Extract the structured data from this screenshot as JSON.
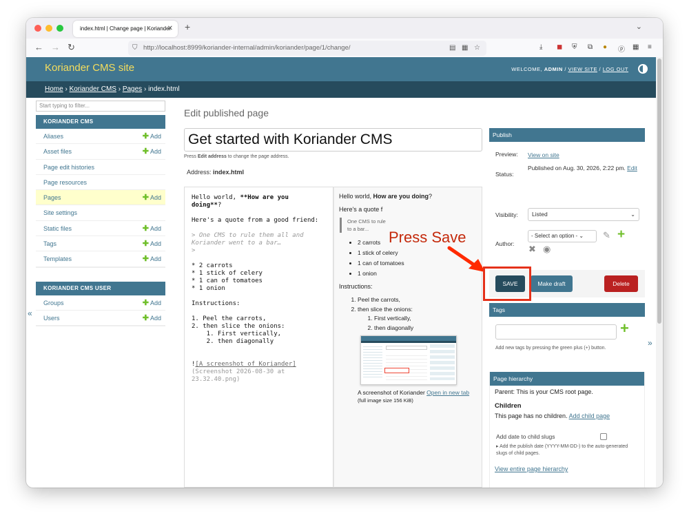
{
  "browser": {
    "tab_title": "index.html | Change page | Koriander",
    "url": "http://localhost:8999/koriander-internal/admin/koriander/page/1/change/"
  },
  "header": {
    "site_title": "Koriander CMS site",
    "welcome": "WELCOME, ",
    "user": "ADMIN",
    "view_site": "VIEW SITE",
    "separator": " / ",
    "logout": "LOG OUT"
  },
  "breadcrumb": {
    "home": "Home",
    "app": "Koriander CMS",
    "model": "Pages",
    "sep": " › ",
    "current": "index.html"
  },
  "sidebar": {
    "filter_placeholder": "Start typing to filter...",
    "add_label": "Add",
    "modules": [
      {
        "caption": "KORIANDER CMS",
        "items": [
          {
            "label": "Aliases",
            "add": true
          },
          {
            "label": "Asset files",
            "add": true
          },
          {
            "label": "Page edit histories",
            "add": false
          },
          {
            "label": "Page resources",
            "add": false
          },
          {
            "label": "Pages",
            "add": true,
            "current": true
          },
          {
            "label": "Site settings",
            "add": false
          },
          {
            "label": "Static files",
            "add": true
          },
          {
            "label": "Tags",
            "add": true
          },
          {
            "label": "Templates",
            "add": true
          }
        ]
      },
      {
        "caption": "KORIANDER CMS USER",
        "items": [
          {
            "label": "Groups",
            "add": true
          },
          {
            "label": "Users",
            "add": true
          }
        ]
      }
    ]
  },
  "main": {
    "page_heading": "Edit published page",
    "title_value": "Get started with Koriander CMS",
    "help_prefix": "Press ",
    "help_bold": "Edit address",
    "help_suffix": " to change the page address.",
    "address_label": "Address: ",
    "address_value": "index.html"
  },
  "markdown": {
    "l1a": "Hello world, ",
    "l1b": "**How are you",
    "l2a": "doing**",
    "l2b": "?",
    "l3": "Here's a quote from a good friend:",
    "q1": "> One CMS to rule them all and",
    "q2": "Koriander went to a bar…",
    "q3": ">",
    "li1": "* 2 carrots",
    "li2": "* 1 stick of celery",
    "li3": "* 1 can of tomatoes",
    "li4": "* 1 onion",
    "ins": "Instructions:",
    "o1": "1. Peel the carrots,",
    "o2": "2. then slice the onions:",
    "o3": "    1. First vertically,",
    "o4": "    2. then diagonally",
    "img_a": "!",
    "img_b": "[A screenshot of Koriander]",
    "img_c": "(Screenshot 2026-08-30 at",
    "img_d": "23.32.40.png)"
  },
  "preview": {
    "p1a": "Hello world, ",
    "p1b": "How are you doing",
    "p1c": "?",
    "p2": "Here's a quote f",
    "quote": "One CMS to rule\nto a bar...",
    "list": [
      "2 carrots",
      "1 stick of celery",
      "1 can of tomatoes",
      "1 onion"
    ],
    "instructions": "Instructions:",
    "steps": [
      "Peel the carrots,",
      "then slice the onions:"
    ],
    "substeps": [
      "First vertically,",
      "then diagonally"
    ],
    "caption": "A screenshot of Koriander ",
    "caption_link": "Open in new tab",
    "caption_size": " (full image size 156 KiB)"
  },
  "publish": {
    "caption": "Publish",
    "preview_label": "Preview:",
    "preview_link": "View on site",
    "status_label": "Status:",
    "status_value": "Published on Aug. 30, 2026, 2:22 pm.",
    "status_edit": "Edit",
    "visibility_label": "Visibility:",
    "visibility_value": "Listed",
    "author_label": "Author:",
    "author_placeholder": "- Select an option -",
    "save": "SAVE",
    "make_draft": "Make draft",
    "delete": "Delete"
  },
  "annotation": {
    "text": "Press Save"
  },
  "tags": {
    "caption": "Tags",
    "help": "Add new tags by pressing the green plus (+) button."
  },
  "hierarchy": {
    "caption": "Page hierarchy",
    "parent_label": "Parent: ",
    "parent_value": "This is your CMS root page.",
    "children_heading": "Children",
    "no_children": "This page has no children. ",
    "add_child": "Add child page",
    "date_label": "Add date to child slugs",
    "date_help": "▸ Add the publish date (YYYY-MM-DD-) to the auto-generated slugs of child pages.",
    "view_all": "View entire page hierarchy"
  },
  "colors": {
    "primary": "#417690",
    "breadcrumb": "#264b5d",
    "accent": "#f5dd5d",
    "add_green": "#70bf2b",
    "delete_red": "#ba2121",
    "highlight": "#e5311a"
  }
}
